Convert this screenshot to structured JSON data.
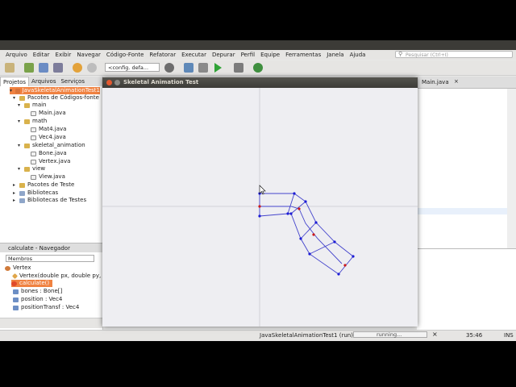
{
  "menu": [
    "Arquivo",
    "Editar",
    "Exibir",
    "Navegar",
    "Código-Fonte",
    "Refatorar",
    "Executar",
    "Depurar",
    "Perfil",
    "Equipe",
    "Ferramentas",
    "Janela",
    "Ajuda"
  ],
  "search": {
    "placeholder": "Pesquisar (Ctrl+I)"
  },
  "toolbar": {
    "config": "<config. defa..."
  },
  "left_tabs": [
    "Projetos",
    "Arquivos",
    "Serviços"
  ],
  "tree": {
    "project": "JavaSkeletalAnimationTest1",
    "sources": "Pacotes de Códigos-fonte",
    "pkg_main": "main",
    "main_java": "Main.java",
    "pkg_math": "math",
    "mat4": "Mat4.java",
    "vec4": "Vec4.java",
    "pkg_skel": "skeletal_animation",
    "bone": "Bone.java",
    "vertex": "Vertex.java",
    "pkg_view": "view",
    "view_java": "View.java",
    "test_pkgs": "Pacotes de Teste",
    "libs": "Bibliotecas",
    "test_libs": "Bibliotecas de Testes"
  },
  "navigator": {
    "title": "calculate - Navegador",
    "filter": "Membros",
    "vertex_class": "Vertex",
    "constructor": "Vertex(double px, double py, B",
    "calculate": "calculate()",
    "bones": "bones : Bone[]",
    "position": "position : Vec4",
    "positionTransf": "positionTransf : Vec4"
  },
  "editor": {
    "tab": "Main.java"
  },
  "app_window": {
    "title": "Skeletal Animation Test"
  },
  "status": {
    "run": "JavaSkeletalAnimationTest1 (run)",
    "progress": "running...",
    "position": "35:46",
    "mode": "INS"
  },
  "colors": {
    "accent": "#f08241",
    "vertex_blue": "#1a1ad6",
    "bone_red": "#cc1a1a",
    "mesh_line": "#4444cc"
  }
}
